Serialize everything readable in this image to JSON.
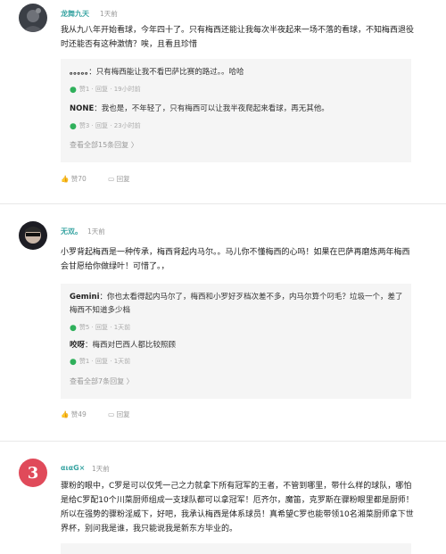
{
  "comments": [
    {
      "username": "龙舞九天",
      "time": "1天前",
      "text": "我从九八年开始看球，今年四十了。只有梅西还能让我每次半夜起来一场不落的看球，不知梅西退役时还能否有这种激情？唉，且看且珍惜",
      "replies": [
        {
          "name": "。。。。。",
          "text": "：只有梅西能让我不看巴萨比赛的路过。。哈哈",
          "likes": "赞1",
          "reply_label": "回复",
          "time": "19小时前"
        },
        {
          "name": "NONE",
          "text": "：我也是，不年轻了，只有梅西可以让我半夜爬起来看球，再无其他。",
          "likes": "赞3",
          "reply_label": "回复",
          "time": "23小时前"
        }
      ],
      "more_replies": "查看全部15条回复",
      "likes": "赞70",
      "reply_label": "回复"
    },
    {
      "username": "无双。",
      "time": "1天前",
      "text": "小罗背起梅西是一种传承，梅西背起内马尔。。马儿你不懂梅西的心吗！如果在巴萨再磨炼两年梅西会甘愿给你做绿叶！可惜了。，",
      "replies": [
        {
          "name": "Gemini",
          "text": "：你也太看得起内马尔了，梅西和小罗好歹档次差不多，内马尔算个叼毛？垃圾一个，差了梅西不知道多少档",
          "likes": "赞5",
          "reply_label": "回复",
          "time": "1天前"
        },
        {
          "name": "咬呀",
          "text": "：梅西对巴西人都比较照顾",
          "likes": "赞1",
          "reply_label": "回复",
          "time": "1天前"
        }
      ],
      "more_replies": "查看全部7条回复",
      "likes": "赞49",
      "reply_label": "回复"
    },
    {
      "username": "αιαG×",
      "time": "1天前",
      "text": "骤粉的眼中，C罗是可以仅凭一己之力就拿下所有冠军的王者，不管到哪里，带什么样的球队，哪怕是给C罗配10个川菜厨师组成一支球队都可以拿冠军！厄齐尔，魔笛，克罗斯在骤粉眼里都是厨师！所以在强势的骤粉淫威下，好吧，我承认梅西是体系球员！真希望C罗也能带领10名湘菜厨师拿下世界杯，别问我是谁，我只能说我是新东方毕业的。",
      "avatar_text": "3"
    }
  ],
  "colors": {
    "username": "#3aa5a3",
    "like_drop": "#2fb05b",
    "reply_bg": "#f5f5f5",
    "avatar3": "#e04a5a"
  }
}
